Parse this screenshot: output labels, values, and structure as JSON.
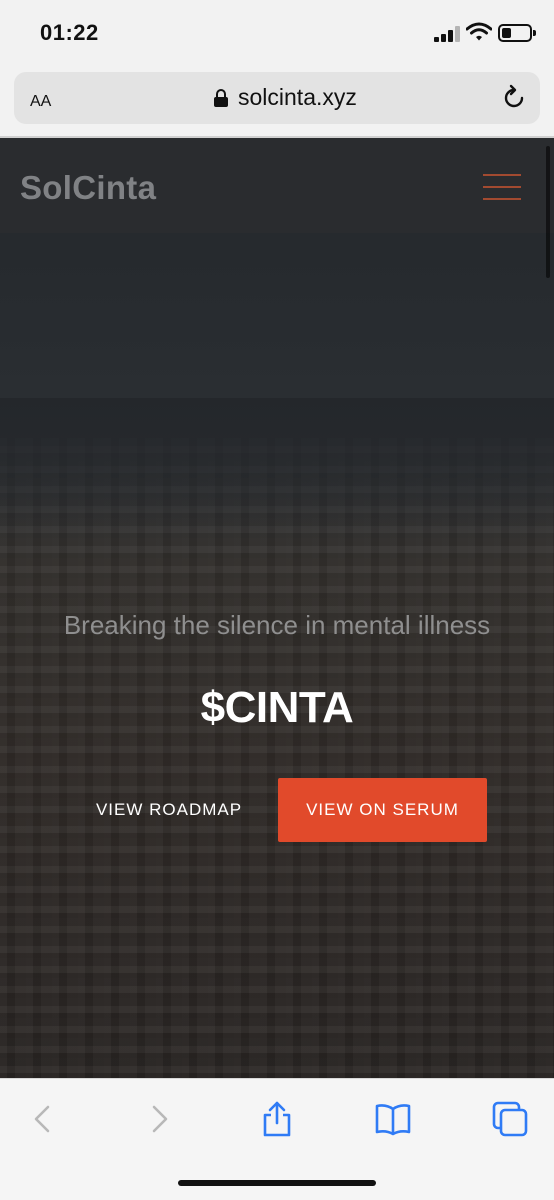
{
  "status_bar": {
    "time": "01:22"
  },
  "browser": {
    "text_size_label": "AA",
    "url": "solcinta.xyz",
    "toolbar": {
      "back_icon": "chevron-left-icon",
      "forward_icon": "chevron-right-icon",
      "share_icon": "share-icon",
      "bookmarks_icon": "book-icon",
      "tabs_icon": "tabs-icon"
    },
    "accent_color": "#2f7bf5"
  },
  "site": {
    "logo": "SolCinta",
    "menu_icon": "hamburger-menu-icon",
    "hero": {
      "tagline": "Breaking the silence in mental illness",
      "ticker": "$CINTA",
      "buttons": {
        "roadmap": "VIEW ROADMAP",
        "serum": "VIEW ON SERUM"
      }
    },
    "colors": {
      "accent": "#e14a2b",
      "menu_icon": "#a24a30"
    }
  }
}
